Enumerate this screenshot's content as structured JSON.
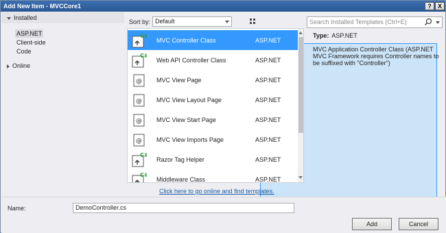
{
  "window": {
    "title": "Add New Item - MVCCore1",
    "help_label": "?",
    "close_label": "X"
  },
  "tree": {
    "installed": "Installed",
    "items": [
      "ASP.NET",
      "Client-side",
      "Code"
    ],
    "online": "Online"
  },
  "toolbar": {
    "sort_label": "Sort by:",
    "sort_value": "Default"
  },
  "search": {
    "placeholder": "Search Installed Templates (Ctrl+E)"
  },
  "templates": [
    {
      "name": "MVC Controller Class",
      "lang": "ASP.NET",
      "icon": "controller-icon",
      "selected": true
    },
    {
      "name": "Web API Controller Class",
      "lang": "ASP.NET",
      "icon": "controller-icon"
    },
    {
      "name": "MVC View Page",
      "lang": "ASP.NET",
      "icon": "razor-page-icon"
    },
    {
      "name": "MVC View Layout Page",
      "lang": "ASP.NET",
      "icon": "razor-page-icon"
    },
    {
      "name": "MVC View Start Page",
      "lang": "ASP.NET",
      "icon": "razor-page-icon"
    },
    {
      "name": "MVC View Imports Page",
      "lang": "ASP.NET",
      "icon": "razor-page-icon"
    },
    {
      "name": "Razor Tag Helper",
      "lang": "ASP.NET",
      "icon": "controller-icon"
    },
    {
      "name": "Middleware Class",
      "lang": "ASP.NET",
      "icon": "controller-icon"
    }
  ],
  "online_link": "Click here to go online and find templates.",
  "details": {
    "type_label": "Type:",
    "type_value": "ASP.NET",
    "description": "MVC Application Controller Class (ASP.NET MVC Framework requires Controller names to be suffixed with \"Controller\")"
  },
  "name_field": {
    "label": "Name:",
    "value": "DemoController.cs"
  },
  "buttons": {
    "add": "Add",
    "cancel": "Cancel"
  },
  "colors": {
    "selection": "#3399ff",
    "link": "#1a5aa6",
    "csharp_badge": "#2e9e3e"
  }
}
